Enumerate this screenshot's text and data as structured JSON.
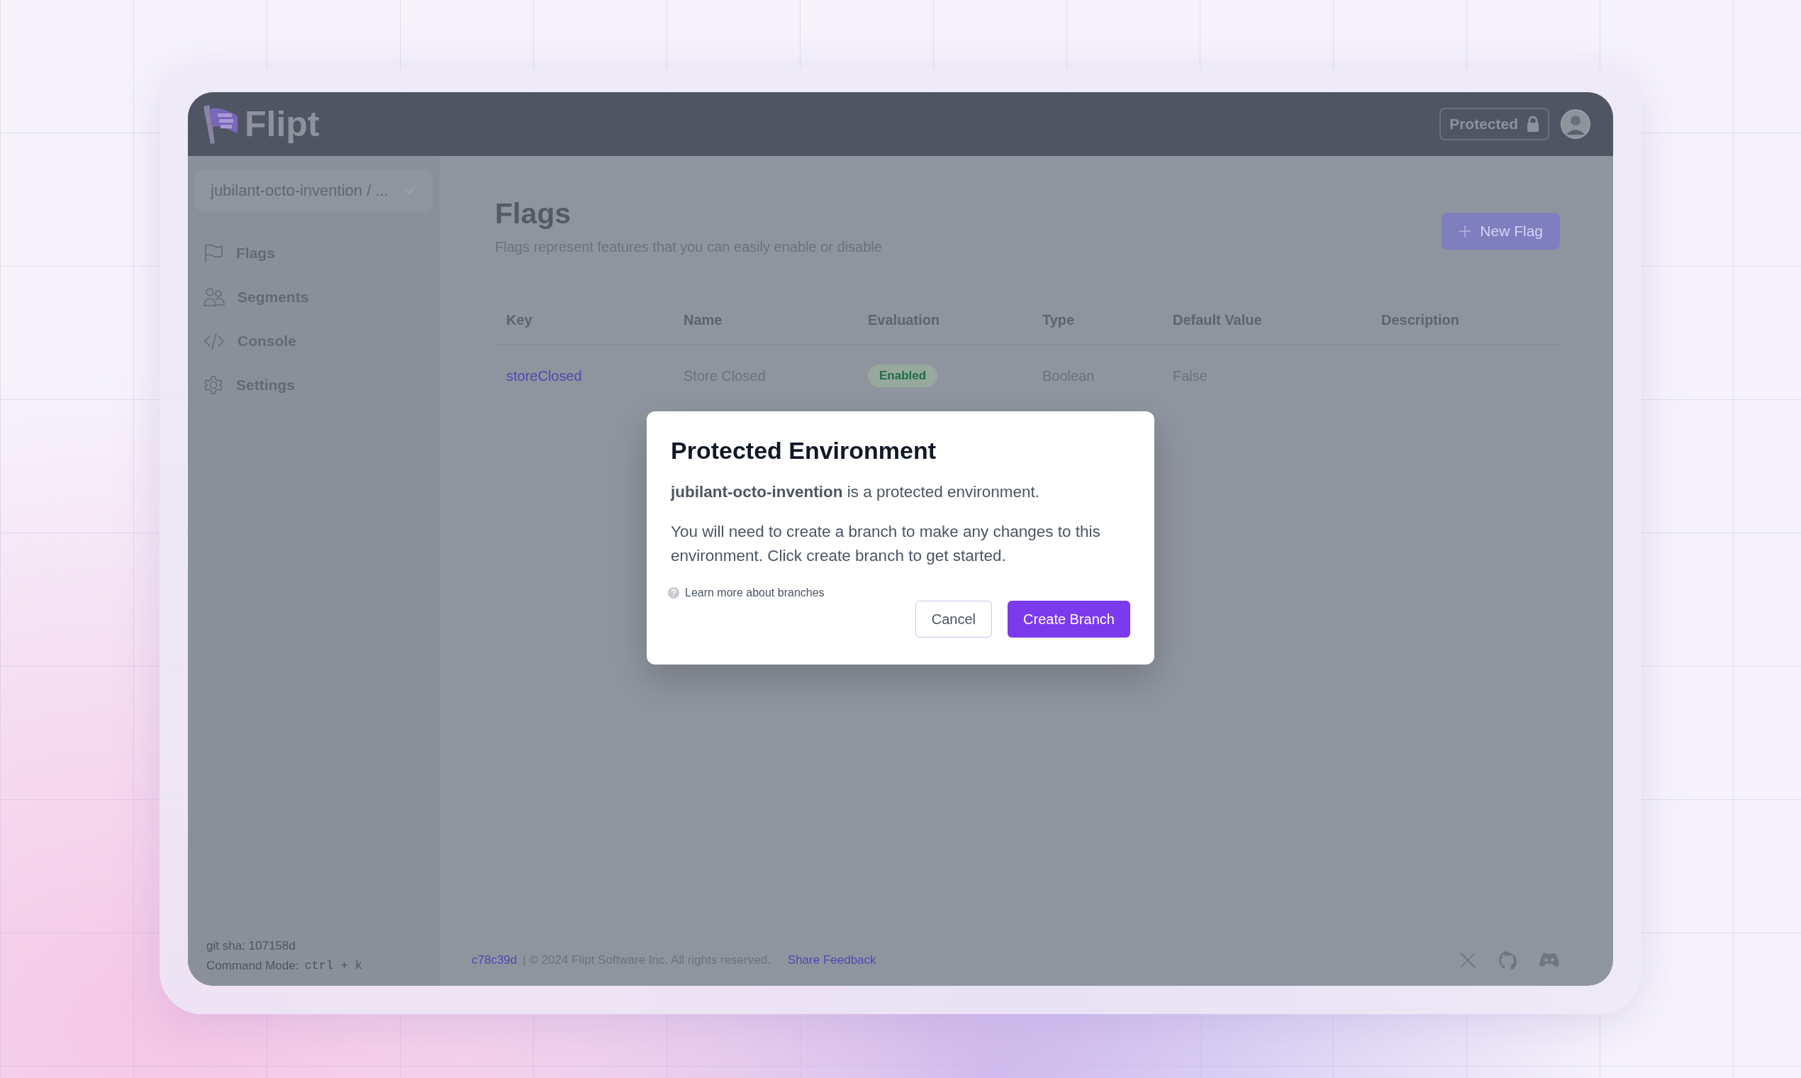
{
  "app": {
    "name": "Flipt"
  },
  "header": {
    "protected_button": "Protected"
  },
  "sidebar": {
    "environment": "jubilant-octo-invention / ...",
    "items": [
      {
        "label": "Flags",
        "kind": "flag"
      },
      {
        "label": "Segments",
        "kind": "users"
      },
      {
        "label": "Console",
        "kind": "code"
      },
      {
        "label": "Settings",
        "kind": "gear"
      }
    ],
    "git_sha": "git sha: 107158d",
    "command_mode": {
      "label": "Command Mode:",
      "shortcut": "ctrl + k"
    }
  },
  "page": {
    "title": "Flags",
    "subtitle": "Flags represent features that you can easily enable or disable",
    "new_button": "New Flag"
  },
  "table": {
    "columns": [
      "Key",
      "Name",
      "Evaluation",
      "Type",
      "Default Value",
      "Description"
    ],
    "rows": [
      {
        "key": "storeClosed",
        "name": "Store Closed",
        "evaluation": "Enabled",
        "enabled": true,
        "type": "Boolean",
        "default_value": "False"
      }
    ]
  },
  "footer": {
    "commit": "c78c39d",
    "copyright": "| © 2024 Flipt Software Inc. All rights reserved.",
    "feedback": "Share Feedback"
  },
  "modal": {
    "title": "Protected Environment",
    "message": "**jubilant-octo-invention** is a protected environment.",
    "body": "You will need to create a branch to make any changes to this environment. Click create branch to get started.",
    "help_link": "Learn more about branches",
    "buttons": [
      {
        "label": "Cancel",
        "kind": "secondary"
      },
      {
        "label": "Create Branch",
        "kind": "primary"
      }
    ]
  }
}
